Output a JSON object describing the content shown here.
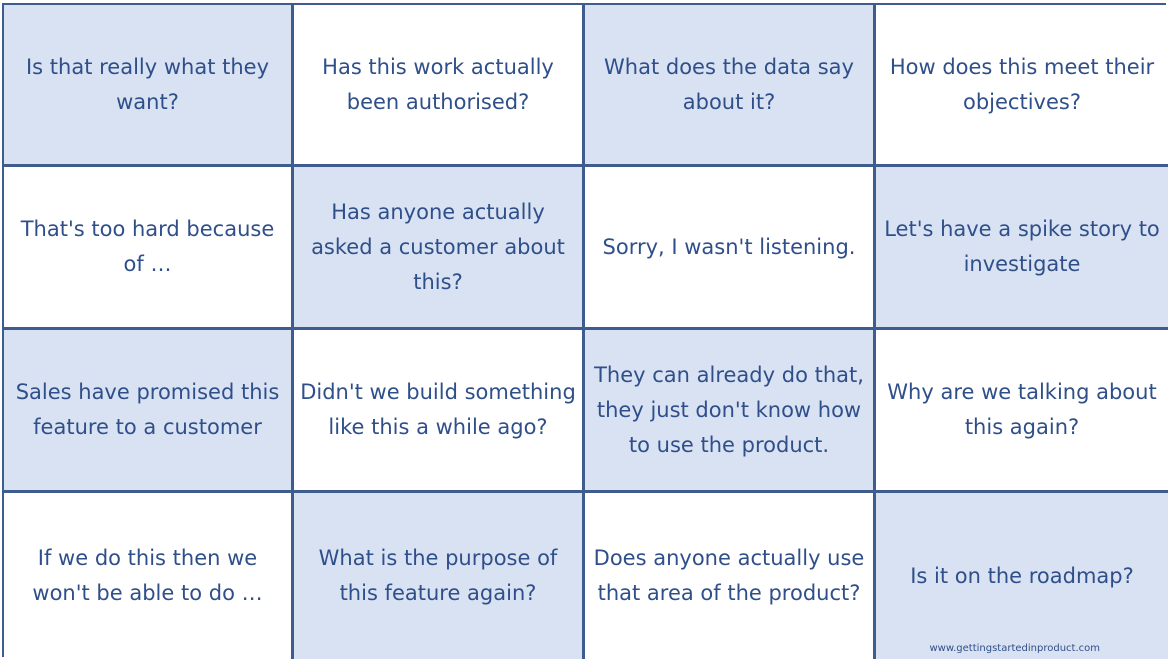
{
  "board": {
    "cells": [
      {
        "text": "Is that really what they want?",
        "shaded": true
      },
      {
        "text": "Has this work actually been authorised?",
        "shaded": false
      },
      {
        "text": "What does the data say about it?",
        "shaded": true
      },
      {
        "text": "How does this meet their objectives?",
        "shaded": false
      },
      {
        "text": "That's too hard because of …",
        "shaded": false
      },
      {
        "text": "Has anyone actually asked a customer about this?",
        "shaded": true
      },
      {
        "text": "Sorry, I wasn't listening.",
        "shaded": false
      },
      {
        "text": "Let's have a spike story to investigate",
        "shaded": true
      },
      {
        "text": "Sales have promised this feature to a customer",
        "shaded": true
      },
      {
        "text": "Didn't we build something like this a while ago?",
        "shaded": false
      },
      {
        "text": "They can already do that, they just don't know how to use the product.",
        "shaded": true
      },
      {
        "text": "Why are we talking about this again?",
        "shaded": false
      },
      {
        "text": "If we do this then we won't be able to do …",
        "shaded": false
      },
      {
        "text": "What is the purpose of this feature again?",
        "shaded": true
      },
      {
        "text": "Does anyone actually use that area of the product?",
        "shaded": false
      },
      {
        "text": "Is it on the roadmap?",
        "shaded": true
      }
    ],
    "credit": "www.gettingstartedinproduct.com",
    "colors": {
      "border": "#3e5c8e",
      "text": "#2f4f8a",
      "shaded_fill": "#d9e2f2",
      "plain_fill": "#ffffff"
    }
  }
}
